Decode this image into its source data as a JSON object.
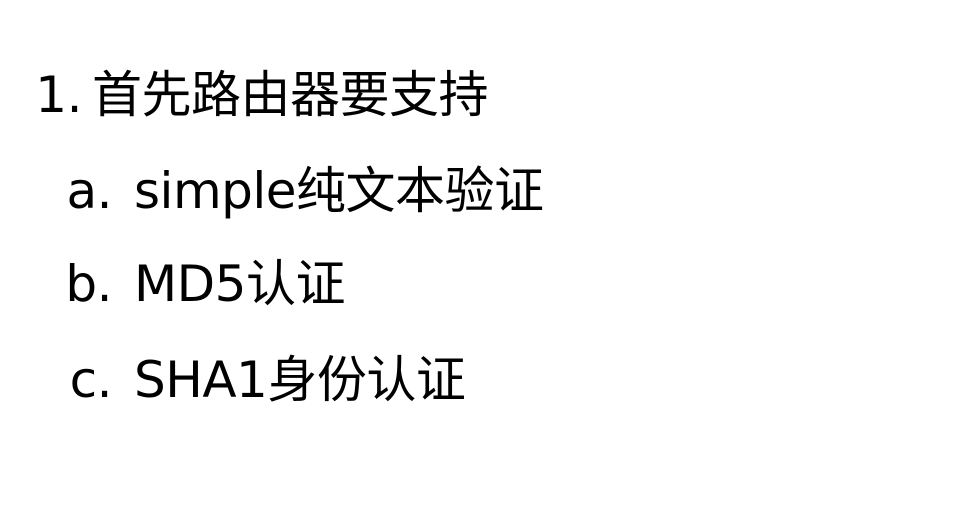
{
  "list": {
    "item": {
      "marker": "1.",
      "text": "首先路由器要支持"
    },
    "subitems": [
      {
        "marker": "a.",
        "text": "simple纯文本验证"
      },
      {
        "marker": "b.",
        "text": "MD5认证"
      },
      {
        "marker": "c.",
        "text": "SHA1身份认证"
      }
    ]
  }
}
